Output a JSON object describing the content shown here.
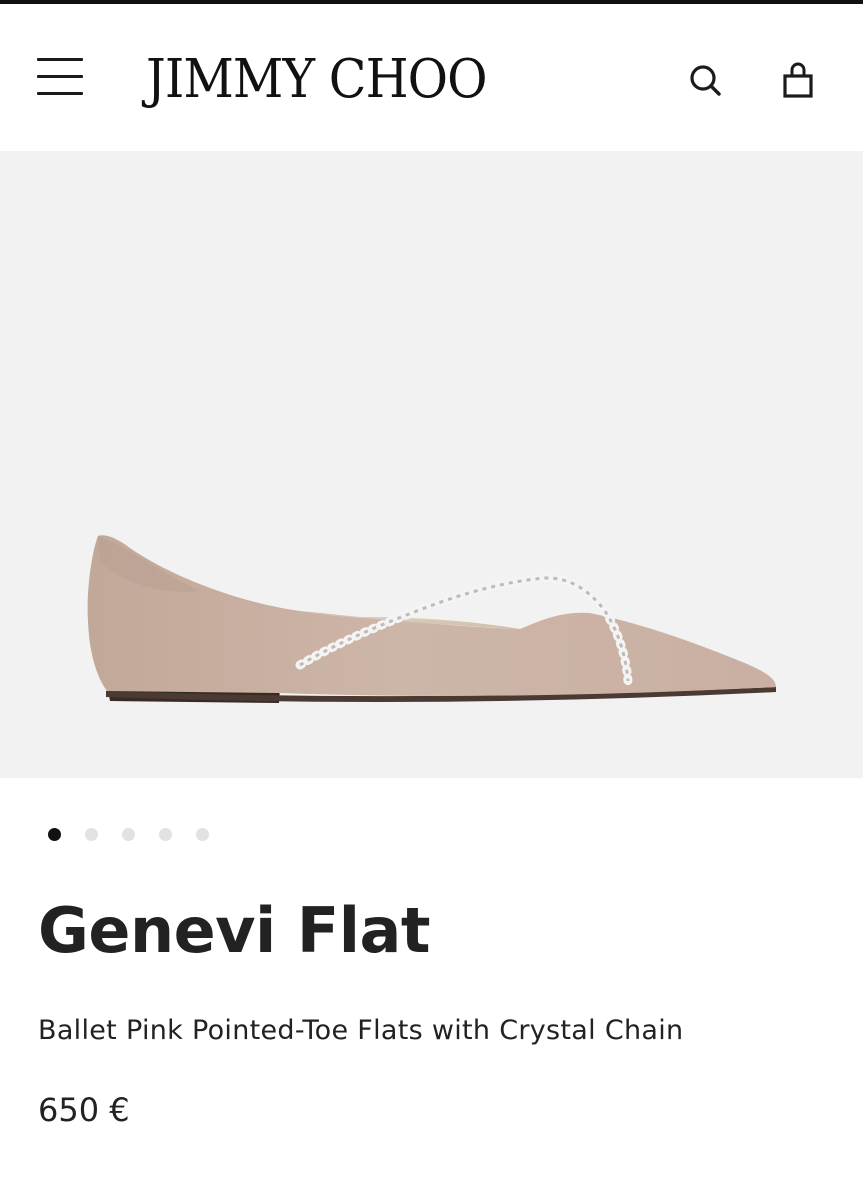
{
  "header": {
    "brand": "JIMMY CHOO",
    "menu_icon": "hamburger-menu-icon",
    "search_icon": "search-icon",
    "bag_icon": "shopping-bag-icon"
  },
  "gallery": {
    "image_count": 5,
    "active_index": 0
  },
  "product": {
    "name": "Genevi Flat",
    "description": "Ballet Pink Pointed-Toe Flats with Crystal Chain",
    "price": "650 €"
  },
  "colors": {
    "hero_background": "#f2f2f2",
    "shoe_suede": "#c8b0a3",
    "dot_active": "#111111",
    "dot_inactive": "#e2e2e2"
  }
}
